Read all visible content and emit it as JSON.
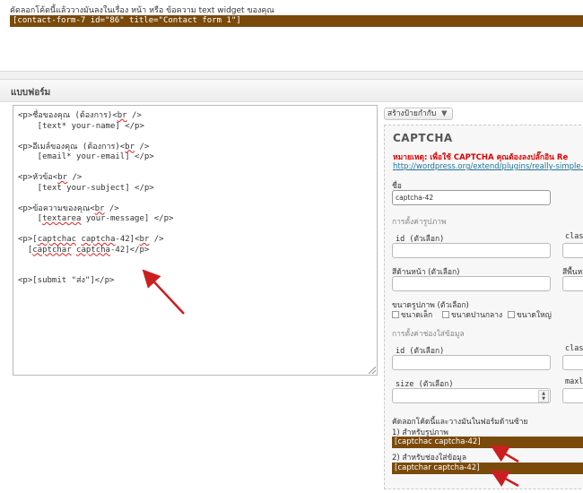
{
  "top": {
    "note": "คัดลอกโค้ดนี้แล้ววางมันลงในเรื่อง หน้า หรือ ข้อความ text widget ของคุณ",
    "shortcode": "[contact-form-7 id=\"86\" title=\"Contact form 1\"]"
  },
  "form_section": {
    "title": "แบบฟอร์ม",
    "lines": [
      "<p>ชื่อของคุณ (ต้องการ)<br />",
      "    [text* your-name] </p>",
      "",
      "<p>อีเมล์ของคุณ (ต้องการ)<br />",
      "    [email* your-email] </p>",
      "",
      "<p>หัวข้อ<br />",
      "    [text your-subject] </p>",
      "",
      "<p>ข้อความของคุณ<br />",
      "    [textarea your-message] </p>",
      "",
      "<p>[captchac captcha-42]<br />",
      "  [captchar captcha-42]</p>",
      "",
      "",
      "<p>[submit \"ส่ง\"]</p>"
    ]
  },
  "tag_generator": {
    "button_label": "สร้างป้ายกำกับ",
    "caret": "▼"
  },
  "captcha": {
    "title": "CAPTCHA",
    "note": "หมายเหตุ: เพื่อใช้ CAPTCHA คุณต้องลงปลั๊กอิน Re",
    "link": "http://wordpress.org/extend/plugins/really-simple-c",
    "name_label": "ชื่อ",
    "name_value": "captcha-42",
    "image_settings_label": "การตั้งค่ารูปภาพ",
    "id_optional": "id (ตัวเลือก)",
    "class_label": "class",
    "fg_color_label": "สีด้านหน้า (ตัวเลือก)",
    "bg_color_label": "สีพื้นหล",
    "image_size_label": "ขนาดรูปภาพ (ตัวเลือก)",
    "size_small": "ขนาดเล็ก",
    "size_medium": "ขนาดปานกลาง",
    "size_large": "ขนาดใหญ่",
    "input_settings_label": "การตั้งค่าช่องใส่ข้อมูล",
    "id_optional_2": "id (ตัวเลือก)",
    "class_label_2": "class",
    "size_optional": "size (ตัวเลือก)",
    "maxlength_label": "maxle",
    "spin_up": "▲",
    "spin_down": "▼",
    "copy_instructions": "คัดลอกโค้ดนี้และวางมันในฟอร์มด้านซ้าย",
    "for_image_label": "1) สำหรับรูปภาพ",
    "for_image_code": "[captchac captcha-42]",
    "for_input_label": "2) สำหรับช่องใส่ข้อมูล",
    "for_input_code": "[captchar captcha-42]"
  },
  "colors": {
    "code_bar": "#7a4a0b",
    "arrow": "#cc1f1f",
    "note_red": "#dd0000",
    "link_blue": "#21759b"
  }
}
